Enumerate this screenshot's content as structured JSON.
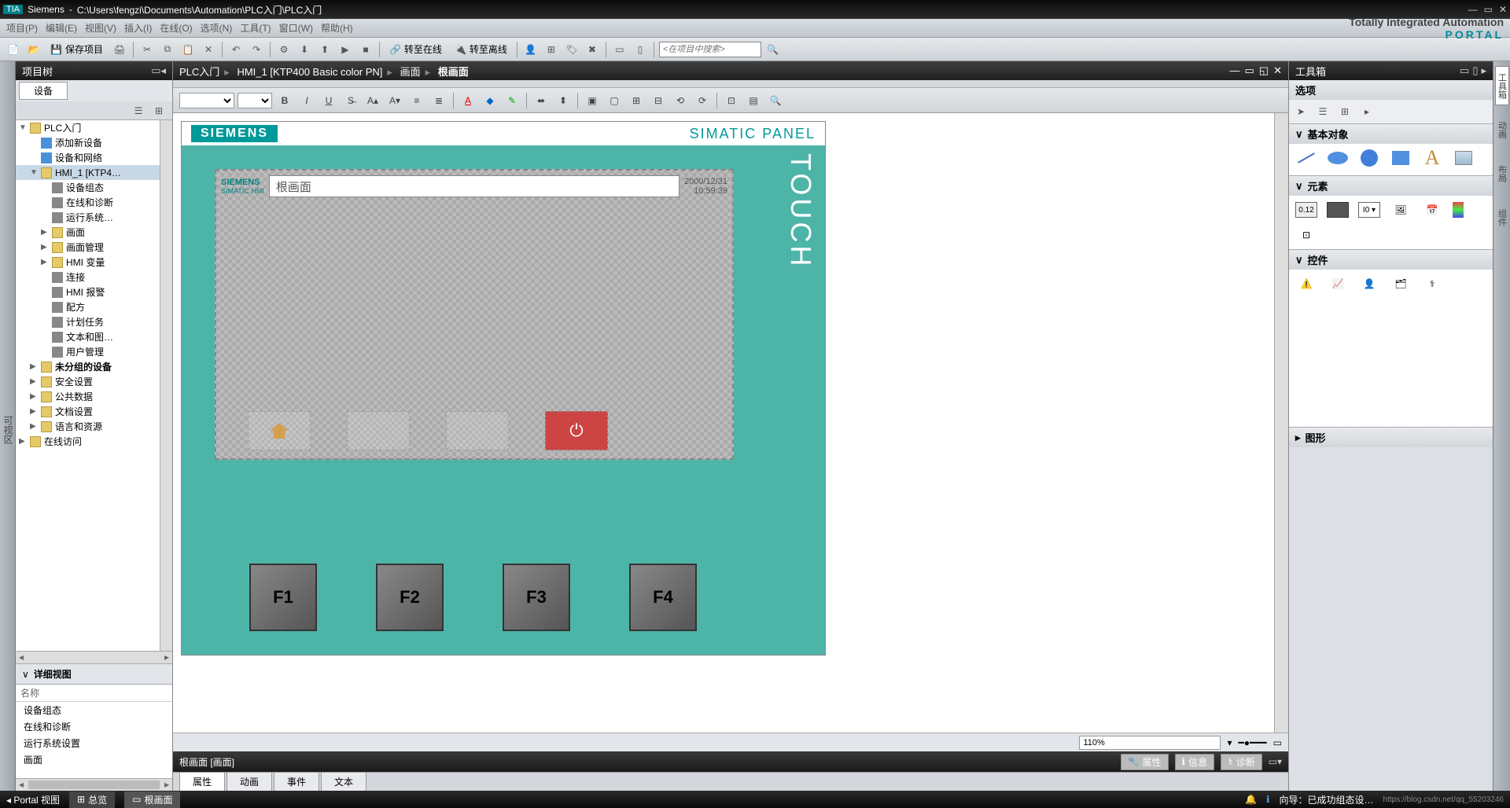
{
  "title": {
    "app": "Siemens",
    "path": "C:\\Users\\fengzi\\Documents\\Automation\\PLC入门\\PLC入门"
  },
  "menus": [
    "项目(P)",
    "编辑(E)",
    "视图(V)",
    "插入(I)",
    "在线(O)",
    "选项(N)",
    "工具(T)",
    "窗口(W)",
    "帮助(H)"
  ],
  "tia": {
    "line1": "Totally Integrated Automation",
    "line2": "PORTAL"
  },
  "toolbar": {
    "save": "保存项目",
    "go_online": "转至在线",
    "go_offline": "转至离线",
    "search_placeholder": "<在项目中搜索>"
  },
  "left_gutter": "可视区",
  "project_tree": {
    "title": "项目树",
    "tab": "设备",
    "nodes": [
      {
        "l": "PLC入门",
        "exp": "▼",
        "ind": 0,
        "ic": "ic-folder"
      },
      {
        "l": "添加新设备",
        "ind": 1,
        "ic": "ic-device"
      },
      {
        "l": "设备和网络",
        "ind": 1,
        "ic": "ic-device"
      },
      {
        "l": "HMI_1 [KTP4…",
        "exp": "▼",
        "ind": 1,
        "ic": "ic-folder",
        "sel": true
      },
      {
        "l": "设备组态",
        "ind": 2,
        "ic": "ic-gear"
      },
      {
        "l": "在线和诊断",
        "ind": 2,
        "ic": "ic-gear"
      },
      {
        "l": "运行系统…",
        "ind": 2,
        "ic": "ic-gear"
      },
      {
        "l": "画面",
        "exp": "▶",
        "ind": 2,
        "ic": "ic-folder"
      },
      {
        "l": "画面管理",
        "exp": "▶",
        "ind": 2,
        "ic": "ic-folder"
      },
      {
        "l": "HMI 变量",
        "exp": "▶",
        "ind": 2,
        "ic": "ic-folder"
      },
      {
        "l": "连接",
        "ind": 2,
        "ic": "ic-gear"
      },
      {
        "l": "HMI 报警",
        "ind": 2,
        "ic": "ic-gear"
      },
      {
        "l": "配方",
        "ind": 2,
        "ic": "ic-gear"
      },
      {
        "l": "计划任务",
        "ind": 2,
        "ic": "ic-gear"
      },
      {
        "l": "文本和图…",
        "ind": 2,
        "ic": "ic-gear"
      },
      {
        "l": "用户管理",
        "ind": 2,
        "ic": "ic-gear"
      },
      {
        "l": "未分组的设备",
        "exp": "▶",
        "ind": 1,
        "ic": "ic-folder",
        "bold": true
      },
      {
        "l": "安全设置",
        "exp": "▶",
        "ind": 1,
        "ic": "ic-folder"
      },
      {
        "l": "公共数据",
        "exp": "▶",
        "ind": 1,
        "ic": "ic-folder"
      },
      {
        "l": "文档设置",
        "exp": "▶",
        "ind": 1,
        "ic": "ic-folder"
      },
      {
        "l": "语言和资源",
        "exp": "▶",
        "ind": 1,
        "ic": "ic-folder"
      },
      {
        "l": "在线访问",
        "exp": "▶",
        "ind": 0,
        "ic": "ic-folder"
      }
    ],
    "detail_title": "详细视图",
    "detail_col": "名称",
    "detail_rows": [
      "设备组态",
      "在线和诊断",
      "运行系统设置",
      "画面"
    ]
  },
  "breadcrumb": {
    "p1": "PLC入门",
    "p2": "HMI_1 [KTP400 Basic color PN]",
    "p3": "画面",
    "p4": "根画面"
  },
  "hmi": {
    "brand": "SIEMENS",
    "panel": "SIMATIC PANEL",
    "touch": "TOUCH",
    "screen_brand": "SIEMENS",
    "screen_sub": "SIMATIC HMI",
    "screen_title": "根画面",
    "date": "2000/12/31",
    "time": "10:59:39",
    "fkeys": [
      "F1",
      "F2",
      "F3",
      "F4"
    ]
  },
  "zoom": "110%",
  "editor_bottom": {
    "title": "根画面 [画面]",
    "props": "属性",
    "info": "信息",
    "diag": "诊断",
    "tabs": [
      "属性",
      "动画",
      "事件",
      "文本"
    ]
  },
  "toolbox": {
    "title": "工具箱",
    "options": "选项",
    "basic": "基本对象",
    "elements": "元素",
    "controls": "控件",
    "graphics": "图形"
  },
  "right_gutter": [
    "工具箱",
    "动画",
    "布局",
    "组件"
  ],
  "status": {
    "portal": "Portal 视图",
    "overview": "总览",
    "screen": "根画面",
    "msg": "向导：已成功组态设…",
    "watermark": "https://blog.csdn.net/qq_55203246"
  }
}
